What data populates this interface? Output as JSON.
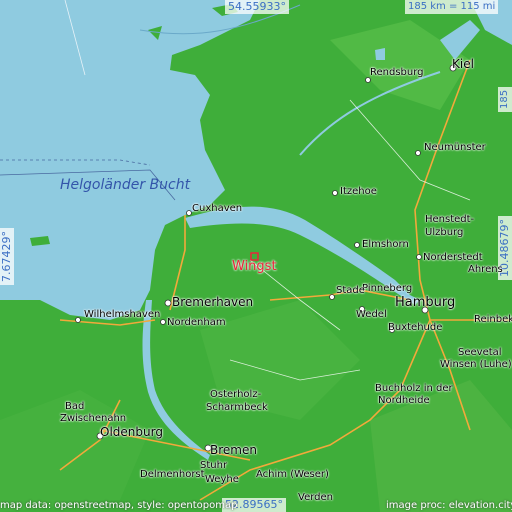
{
  "coordinates": {
    "top": "54.55933°",
    "bottom": "52.89565°",
    "left": "7.67429°",
    "right": "10.48679°"
  },
  "scale": {
    "horizontal": "185 km = 115 mi",
    "vertical": "185 km = 115 mi"
  },
  "highlight": {
    "name": "Wingst",
    "color": "#e8263a"
  },
  "sea_label": "Helgoländer Bucht",
  "places": {
    "kiel": "Kiel",
    "rendsburg": "Rendsburg",
    "neumuenster": "Neumünster",
    "itzehoe": "Itzehoe",
    "cuxhaven": "Cuxhaven",
    "henstedt": "Henstedt-",
    "ulzburg": "Ulzburg",
    "elmshorn": "Elmshorn",
    "norderstedt": "Norderstedt",
    "ahrensburg": "Ahrens",
    "pinneberg": "Pinneberg",
    "stade": "Stade",
    "hamburg": "Hamburg",
    "bremerhaven": "Bremerhaven",
    "wilhelmshaven": "Wilhelmshaven",
    "nordenham": "Nordenham",
    "wedel": "Wedel",
    "buxtehude": "Buxtehude",
    "reinbek": "Reinbek",
    "seevetal": "Seevetal",
    "winsen": "Winsen (Luhe)",
    "buchholz": "Buchholz in der",
    "nordheide": "Nordheide",
    "osterholz": "Osterholz-",
    "scharmbeck": "Scharmbeck",
    "bad": "Bad",
    "zwischenahn": "Zwischenahn",
    "oldenburg": "Oldenburg",
    "bremen": "Bremen",
    "stuhr": "Stuhr",
    "delmenhorst": "Delmenhorst",
    "weyhe": "Weyhe",
    "achim": "Achim (Weser)",
    "verden": "Verden"
  },
  "attribution": {
    "left": "map data: openstreetmap, style: opentopomap",
    "right": "image proc: elevation.city"
  },
  "colors": {
    "sea": "#8fcbe0",
    "land": "#3fae3a",
    "coord_text": "#3b6fc4"
  }
}
